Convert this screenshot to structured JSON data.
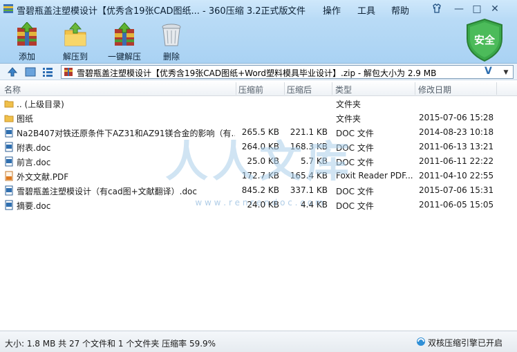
{
  "window": {
    "title": "雪碧瓶盖注塑模设计【优秀含19张CAD图纸... - 360压缩 3.2正式版",
    "menus": [
      "文件",
      "操作",
      "工具",
      "帮助"
    ],
    "controls": {
      "minimize": "—",
      "maximize": "□",
      "close": "✕"
    }
  },
  "toolbar": {
    "add": "添加",
    "extract_to": "解压到",
    "one_click_extract": "一键解压",
    "delete": "删除"
  },
  "security_badge": "安全",
  "address": {
    "path": "雪碧瓶盖注塑模设计【优秀含19张CAD图纸+Word塑料模具毕业设计】.zip - 解包大小为 2.9 MB"
  },
  "columns": {
    "name": "名称",
    "compressed_before": "压缩前",
    "compressed_after": "压缩后",
    "type": "类型",
    "modified": "修改日期"
  },
  "files": [
    {
      "name": ".. (上级目录)",
      "before": "",
      "after": "",
      "type": "文件夹",
      "date": "",
      "icon": "folder-up"
    },
    {
      "name": "图纸",
      "before": "",
      "after": "",
      "type": "文件夹",
      "date": "2015-07-06 15:28",
      "icon": "folder"
    },
    {
      "name": "Na2B407对铁还原条件下AZ31和AZ91镁合金的影响（有...",
      "before": "265.5 KB",
      "after": "221.1 KB",
      "type": "DOC 文件",
      "date": "2014-08-23 10:18",
      "icon": "doc"
    },
    {
      "name": "附表.doc",
      "before": "264.0 KB",
      "after": "168.3 KB",
      "type": "DOC 文件",
      "date": "2011-06-13 13:21",
      "icon": "doc"
    },
    {
      "name": "前言.doc",
      "before": "25.0 KB",
      "after": "5.7 KB",
      "type": "DOC 文件",
      "date": "2011-06-11 22:22",
      "icon": "doc"
    },
    {
      "name": "外文文献.PDF",
      "before": "172.7 KB",
      "after": "165.4 KB",
      "type": "Foxit Reader PDF...",
      "date": "2011-04-10 22:55",
      "icon": "pdf"
    },
    {
      "name": "雪碧瓶盖注塑模设计（有cad图+文献翻译）.doc",
      "before": "845.2 KB",
      "after": "337.1 KB",
      "type": "DOC 文件",
      "date": "2015-07-06 15:31",
      "icon": "doc"
    },
    {
      "name": "摘要.doc",
      "before": "24.0 KB",
      "after": "4.4 KB",
      "type": "DOC 文件",
      "date": "2011-06-05 15:05",
      "icon": "doc"
    }
  ],
  "watermark": {
    "text": "人人文库",
    "url": "w w w . r e n r e n d o c . c o m"
  },
  "status": {
    "summary": "大小: 1.8 MB 共 27 个文件和 1 个文件夹 压缩率 59.9%",
    "engine": "双核压缩引擎已开启"
  },
  "colors": {
    "accent": "#2f6fb0",
    "chrome": "#b9dbf6",
    "shield": "#3aa84a"
  }
}
